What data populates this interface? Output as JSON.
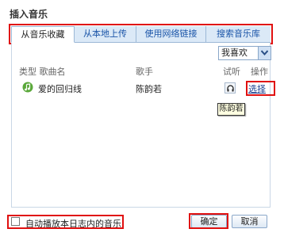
{
  "dialog": {
    "title": "插入音乐"
  },
  "tabs": [
    {
      "label": "从音乐收藏",
      "active": true
    },
    {
      "label": "从本地上传",
      "active": false
    },
    {
      "label": "使用网络链接",
      "active": false
    },
    {
      "label": "搜索音乐库",
      "active": false
    }
  ],
  "filter": {
    "selected": "我喜欢"
  },
  "table": {
    "headers": {
      "type_name": "类型 歌曲名",
      "singer": "歌手",
      "listen": "试听",
      "action": "操作"
    },
    "rows": [
      {
        "icon": "music-note-icon",
        "song": "爱的回归线",
        "singer": "陈韵若",
        "listen_icon": "headphones-icon",
        "action": "选择"
      }
    ]
  },
  "tooltip": {
    "text": "陈韵若"
  },
  "footer": {
    "autoplay_label": "自动播放本日志内的音乐",
    "autoplay_checked": false,
    "ok": "确定",
    "cancel": "取消"
  },
  "colors": {
    "highlight": "#e01010",
    "link": "#1b55a8",
    "tabbar": "#dbe9f7"
  }
}
